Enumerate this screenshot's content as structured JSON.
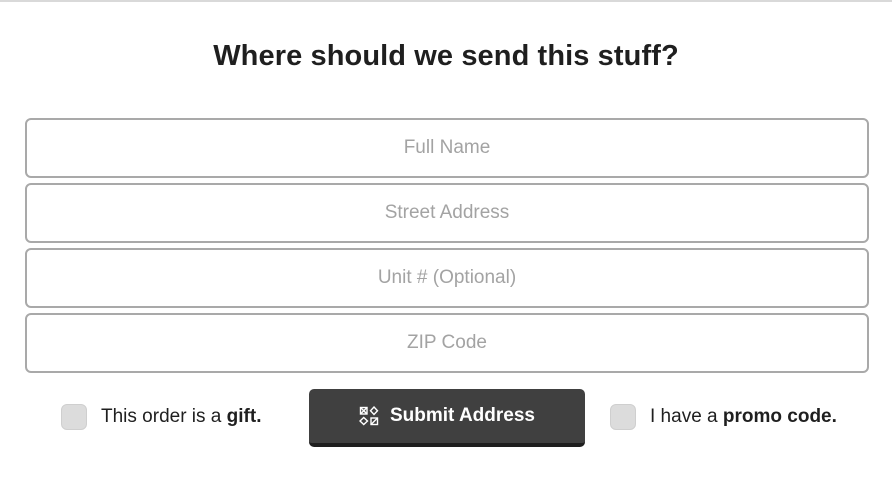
{
  "title": "Where should we send this stuff?",
  "fields": {
    "full_name": {
      "placeholder": "Full Name",
      "value": ""
    },
    "street_address": {
      "placeholder": "Street Address",
      "value": ""
    },
    "unit": {
      "placeholder": "Unit # (Optional)",
      "value": ""
    },
    "zip": {
      "placeholder": "ZIP Code",
      "value": ""
    }
  },
  "gift_option": {
    "prefix": "This order is a ",
    "bold": "gift.",
    "checked": false
  },
  "promo_option": {
    "prefix": "I have a ",
    "bold": "promo code.",
    "checked": false
  },
  "submit": {
    "label": "Submit Address",
    "icon": "address-grid-icon"
  },
  "colors": {
    "button_bg": "#404040",
    "field_border": "#a9a9a9",
    "checkbox_bg": "#dcdcdc",
    "placeholder": "#a3a3a3"
  }
}
